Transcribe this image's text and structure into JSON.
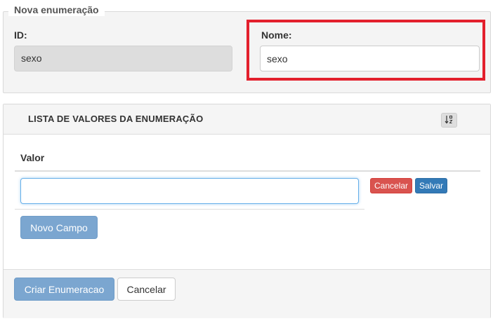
{
  "form": {
    "legend": "Nova enumeração",
    "id_label": "ID:",
    "id_value": "sexo",
    "nome_label": "Nome:",
    "nome_value": "sexo"
  },
  "values_panel": {
    "title": "LISTA DE VALORES DA ENUMERAÇÃO",
    "sort_icon": "sort-alpha-icon",
    "column_header": "Valor",
    "row_input_value": "",
    "row_cancel_label": "Cancelar",
    "row_save_label": "Salvar",
    "new_field_label": "Novo Campo"
  },
  "footer": {
    "create_label": "Criar Enumeracao",
    "cancel_label": "Cancelar"
  },
  "colors": {
    "highlight": "#e3202d",
    "danger": "#d9534f",
    "primary": "#337ab7",
    "primary_disabled": "#7ba6d0"
  }
}
